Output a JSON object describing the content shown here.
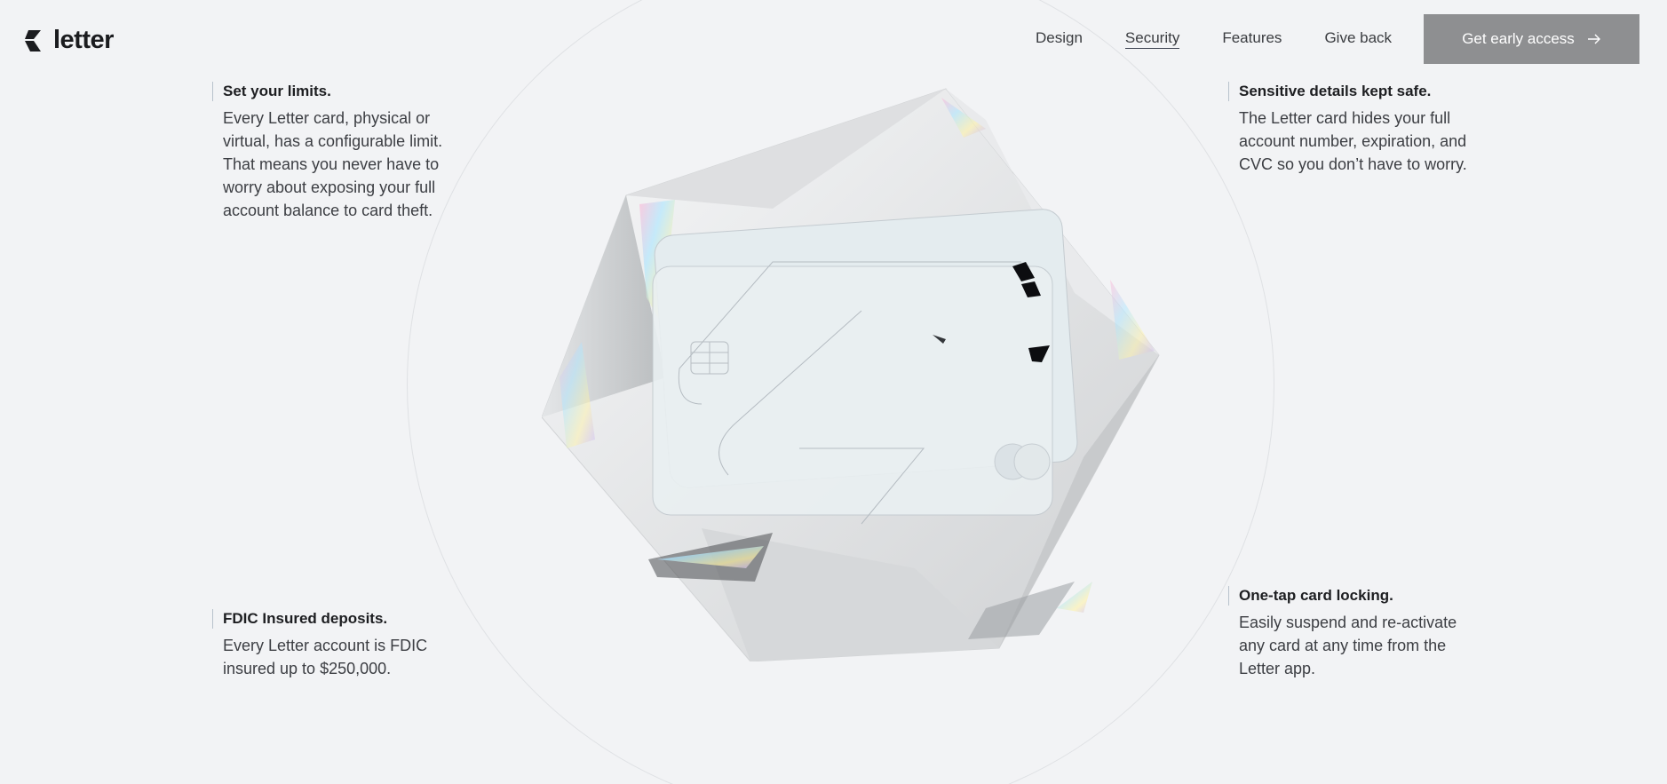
{
  "brand": {
    "name": "letter",
    "logo_icon": "letter-logo-icon"
  },
  "nav": {
    "items": [
      {
        "label": "Design"
      },
      {
        "label": "Security",
        "active": true
      },
      {
        "label": "Features"
      },
      {
        "label": "Give back"
      }
    ],
    "cta_label": "Get early access",
    "cta_icon": "arrow-right-icon"
  },
  "features": {
    "limits": {
      "title": "Set your limits.",
      "body": "Every Letter card, physical or virtual, has a configurable limit. That means you never have to worry about exposing your full account balance to card theft."
    },
    "details": {
      "title": "Sensitive details kept safe.",
      "body": "The Letter card hides your full account number, expiration, and CVC so you don’t have to worry."
    },
    "fdic": {
      "title": "FDIC Insured deposits.",
      "body": "Every Letter account is FDIC insured up to $250,000."
    },
    "locking": {
      "title": "One-tap card locking.",
      "body": "Easily suspend and re-activate any card at any time from the Letter app."
    }
  },
  "colors": {
    "background": "#f2f3f5",
    "cta_bg": "#8e8f91",
    "text": "#2a2c30"
  }
}
